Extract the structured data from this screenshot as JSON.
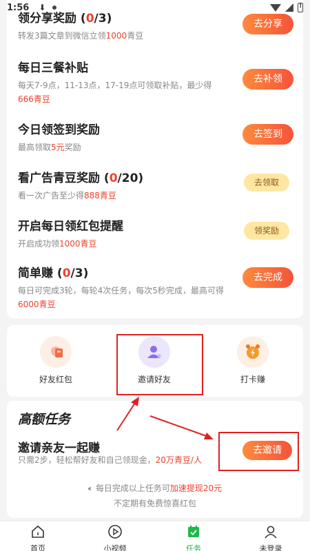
{
  "status_bar": {
    "time": "1:56"
  },
  "tasks": [
    {
      "title_pre": "领分享奖励 (",
      "title_hl": "0",
      "title_post": "/3)",
      "desc_pre": "转发3篇文章到微信立领",
      "desc_hl": "1000",
      "desc_post": "青豆",
      "button": "去分享",
      "button_style": "red"
    },
    {
      "title_pre": "每日三餐补贴",
      "title_hl": "",
      "title_post": "",
      "desc_pre": "每天7-9点，11-13点，17-19点可领取补贴，最少得",
      "desc_hl": "666青豆",
      "desc_post": "",
      "button": "去补领",
      "button_style": "red"
    },
    {
      "title_pre": "今日领签到奖励",
      "title_hl": "",
      "title_post": "",
      "desc_pre": "最高领取",
      "desc_hl": "5元",
      "desc_post": "奖励",
      "button": "去签到",
      "button_style": "red"
    },
    {
      "title_pre": "看广告青豆奖励 (",
      "title_hl": "0",
      "title_post": "/20)",
      "desc_pre": "看一次广告至少得",
      "desc_hl": "888青豆",
      "desc_post": "",
      "button": "去领取",
      "button_style": "yellow"
    },
    {
      "title_pre": "开启每日领红包提醒",
      "title_hl": "",
      "title_post": "",
      "desc_pre": "开启成功领",
      "desc_hl": "1000青豆",
      "desc_post": "",
      "button": "领奖励",
      "button_style": "yellow"
    },
    {
      "title_pre": "简单赚 (",
      "title_hl": "0",
      "title_post": "/3)",
      "desc_pre": "每日可完成3轮，每轮4次任务，每次5秒完成，最高可得",
      "desc_hl": "6000青豆",
      "desc_post": "",
      "button": "去完成",
      "button_style": "red"
    }
  ],
  "quick_actions": [
    {
      "label": "好友红包",
      "icon": "red-packet-icon",
      "color": "#fdeee6"
    },
    {
      "label": "邀请好友",
      "icon": "invite-user-icon",
      "color": "#ece6fb"
    },
    {
      "label": "打卡赚",
      "icon": "alarm-clock-icon",
      "color": "#fdefe3"
    }
  ],
  "high_reward": {
    "title": "高额任务",
    "task_title": "邀请亲友一起赚",
    "task_desc_pre": "只需2步，轻松帮好友和自己领现金，",
    "task_desc_hl": "20万青豆/人",
    "button": "去邀请",
    "tip1_pre": "每日完成以上任务可",
    "tip1_hl": "加速提现20元",
    "tip2": "不定期有免费惊喜红包"
  },
  "tabs": [
    {
      "label": "首页",
      "icon": "home-icon",
      "active": false
    },
    {
      "label": "小视频",
      "icon": "play-icon",
      "active": false
    },
    {
      "label": "任务",
      "icon": "task-calendar-icon",
      "active": true
    },
    {
      "label": "未登录",
      "icon": "user-icon",
      "active": false
    }
  ],
  "colors": {
    "accent_red": "#f0412b",
    "active_green": "#1fb84a",
    "annotation_red": "#e02020"
  }
}
